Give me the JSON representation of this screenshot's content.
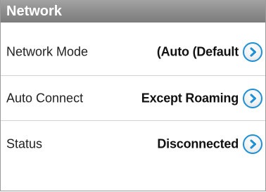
{
  "header": {
    "title": "Network"
  },
  "settings": [
    {
      "label": "Network Mode",
      "value": "(Auto (Default"
    },
    {
      "label": "Auto Connect",
      "value": "Except Roaming"
    },
    {
      "label": "Status",
      "value": "Disconnected"
    }
  ],
  "icons": {
    "row_action": "chevron-right-icon"
  },
  "colors": {
    "accent": "#1e90d6",
    "header_bg": "#8e8e8e"
  }
}
